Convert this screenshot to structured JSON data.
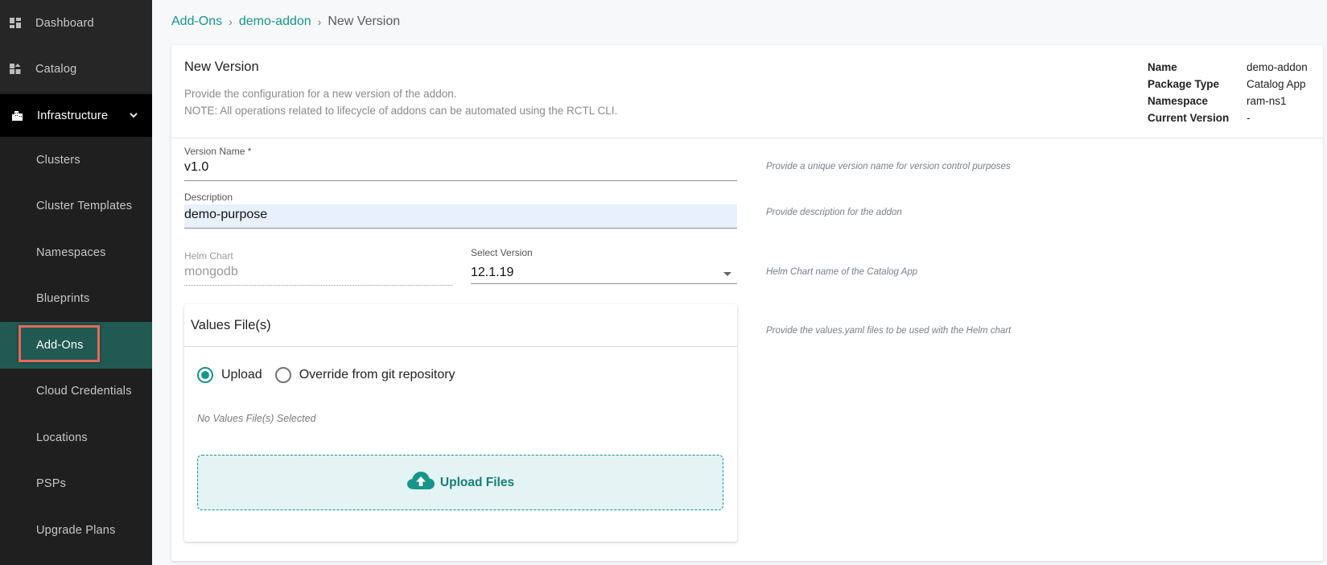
{
  "sidebar": {
    "top_items": [
      {
        "label": "Dashboard",
        "icon": "dashboard-icon"
      },
      {
        "label": "Catalog",
        "icon": "catalog-icon"
      }
    ],
    "section": {
      "label": "Infrastructure",
      "icon": "infrastructure-icon",
      "expanded": true
    },
    "sub_items": [
      {
        "label": "Clusters"
      },
      {
        "label": "Cluster Templates"
      },
      {
        "label": "Namespaces"
      },
      {
        "label": "Blueprints"
      },
      {
        "label": "Add-Ons",
        "active": true
      },
      {
        "label": "Cloud Credentials"
      },
      {
        "label": "Locations"
      },
      {
        "label": "PSPs"
      },
      {
        "label": "Upgrade Plans"
      }
    ]
  },
  "breadcrumb": {
    "items": [
      "Add-Ons",
      "demo-addon"
    ],
    "current": "New Version",
    "separator": "›"
  },
  "header": {
    "title": "New Version",
    "description_line1": "Provide the configuration for a new version of the addon.",
    "description_line2": "NOTE: All operations related to lifecycle of addons can be automated using the RCTL CLI."
  },
  "meta": [
    {
      "key": "Name",
      "value": "demo-addon"
    },
    {
      "key": "Package Type",
      "value": "Catalog App"
    },
    {
      "key": "Namespace",
      "value": "ram-ns1"
    },
    {
      "key": "Current Version",
      "value": "-"
    }
  ],
  "form": {
    "version_name": {
      "label": "Version Name *",
      "value": "v1.0",
      "hint": "Provide a unique version name for version control purposes"
    },
    "description": {
      "label": "Description",
      "value": "demo-purpose",
      "hint": "Provide description for the addon"
    },
    "helm_chart": {
      "label": "Helm Chart",
      "value": "mongodb",
      "hint": "Helm Chart name of the Catalog App"
    },
    "select_version": {
      "label": "Select Version",
      "value": "12.1.19"
    },
    "values_files": {
      "title": "Values File(s)",
      "hint": "Provide the values.yaml files to be used with the Helm chart",
      "options": [
        {
          "label": "Upload",
          "selected": true
        },
        {
          "label": "Override from git repository",
          "selected": false
        }
      ],
      "empty_text": "No Values File(s) Selected",
      "upload_label": "Upload Files"
    }
  },
  "colors": {
    "accent": "#16968a",
    "sidebar_bg": "#1f1f1f",
    "sidebar_active": "#215a52",
    "highlight_box": "#e8685a",
    "dropzone_bg": "#e4f3f3"
  }
}
